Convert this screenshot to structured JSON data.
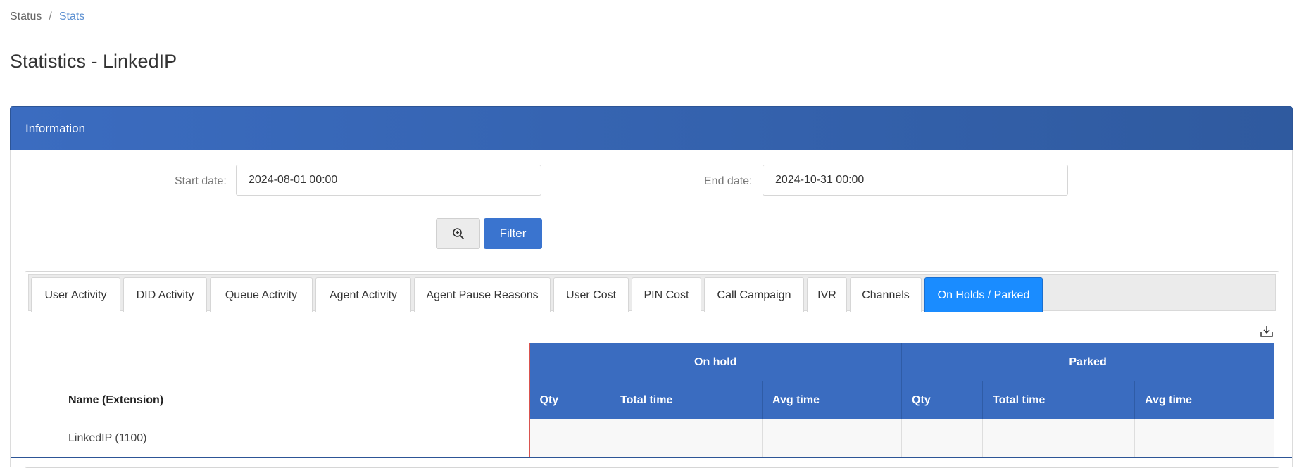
{
  "breadcrumb": {
    "root": "Status",
    "separator": "/",
    "current": "Stats"
  },
  "page": {
    "title": "Statistics - LinkedIP"
  },
  "panel": {
    "title": "Information"
  },
  "filters": {
    "start_label": "Start date:",
    "start_value": "2024-08-01 00:00",
    "end_label": "End date:",
    "end_value": "2024-10-31 00:00",
    "filter_label": "Filter"
  },
  "tabs": [
    {
      "label": "User Activity"
    },
    {
      "label": "DID Activity"
    },
    {
      "label": "Queue Activity"
    },
    {
      "label": "Agent Activity"
    },
    {
      "label": "Agent Pause Reasons"
    },
    {
      "label": "User Cost"
    },
    {
      "label": "PIN Cost"
    },
    {
      "label": "Call Campaign"
    },
    {
      "label": "IVR"
    },
    {
      "label": "Channels"
    },
    {
      "label": "On Holds / Parked",
      "active": true
    }
  ],
  "table": {
    "groups": [
      "On hold",
      "Parked"
    ],
    "name_header": "Name (Extension)",
    "columns": [
      "Qty",
      "Total time",
      "Avg time",
      "Qty",
      "Total time",
      "Avg time"
    ],
    "rows": [
      {
        "name": "LinkedIP (1100)"
      }
    ]
  },
  "colors": {
    "accent": "#3a6cc0",
    "active_tab": "#1a8cff",
    "header_gradient_start": "#3b6cc0"
  },
  "icons": {
    "zoom": "zoom-in-icon",
    "download": "download-icon"
  }
}
